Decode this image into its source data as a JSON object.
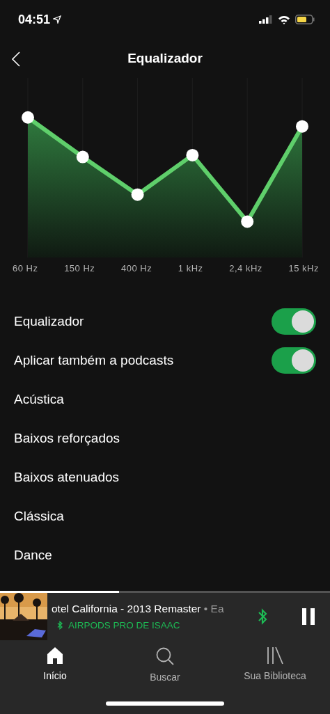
{
  "status_bar": {
    "time": "04:51"
  },
  "header": {
    "title": "Equalizador"
  },
  "equalizer": {
    "bands": [
      {
        "label": "60 Hz"
      },
      {
        "label": "150 Hz"
      },
      {
        "label": "400 Hz"
      },
      {
        "label": "1 kHz"
      },
      {
        "label": "2,4 kHz"
      },
      {
        "label": "15 kHz"
      }
    ]
  },
  "settings": [
    {
      "kind": "toggle",
      "label": "Equalizador",
      "on": true
    },
    {
      "kind": "toggle",
      "label": "Aplicar também a podcasts",
      "on": true
    },
    {
      "kind": "preset",
      "label": "Acústica"
    },
    {
      "kind": "preset",
      "label": "Baixos reforçados"
    },
    {
      "kind": "preset",
      "label": "Baixos atenuados"
    },
    {
      "kind": "preset",
      "label": "Clássica"
    },
    {
      "kind": "preset",
      "label": "Dance"
    }
  ],
  "now_playing": {
    "title": "otel California - 2013 Remaster",
    "artist": "• Ea",
    "device": "AIRPODS PRO DE ISAAC",
    "level": 0.36
  },
  "tabs": [
    {
      "label": "Início",
      "selected": true
    },
    {
      "label": "Buscar",
      "selected": false
    },
    {
      "label": "Sua Biblioteca",
      "selected": false
    }
  ]
}
